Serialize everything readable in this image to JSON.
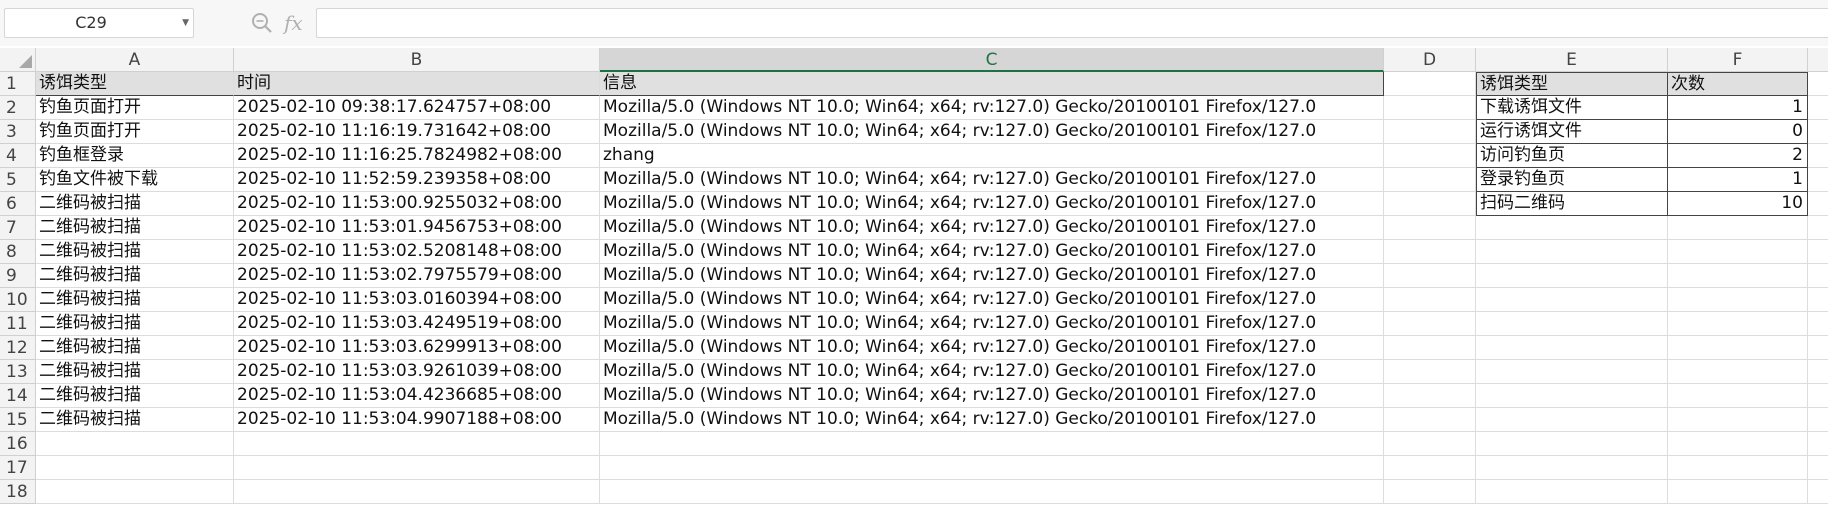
{
  "formula_bar": {
    "name_box": "C29",
    "fx_symbol": "fx",
    "formula_value": ""
  },
  "columns": [
    {
      "label": "A",
      "selected": false
    },
    {
      "label": "B",
      "selected": false
    },
    {
      "label": "C",
      "selected": true
    },
    {
      "label": "D",
      "selected": false
    },
    {
      "label": "E",
      "selected": false
    },
    {
      "label": "F",
      "selected": false
    }
  ],
  "rows": [
    {
      "n": "1",
      "a": "诱饵类型",
      "b": "时间",
      "c": "信息",
      "e": "诱饵类型",
      "f": "次数"
    },
    {
      "n": "2",
      "a": "钓鱼页面打开",
      "b": "2025-02-10 09:38:17.624757+08:00",
      "c": "Mozilla/5.0 (Windows NT 10.0; Win64; x64; rv:127.0) Gecko/20100101 Firefox/127.0",
      "e": "下载诱饵文件",
      "f": "1"
    },
    {
      "n": "3",
      "a": "钓鱼页面打开",
      "b": "2025-02-10 11:16:19.731642+08:00",
      "c": "Mozilla/5.0 (Windows NT 10.0; Win64; x64; rv:127.0) Gecko/20100101 Firefox/127.0",
      "e": "运行诱饵文件",
      "f": "0"
    },
    {
      "n": "4",
      "a": "钓鱼框登录",
      "b": "2025-02-10 11:16:25.7824982+08:00",
      "c": "zhang",
      "e": "访问钓鱼页",
      "f": "2"
    },
    {
      "n": "5",
      "a": "钓鱼文件被下载",
      "b": "2025-02-10 11:52:59.239358+08:00",
      "c": "Mozilla/5.0 (Windows NT 10.0; Win64; x64; rv:127.0) Gecko/20100101 Firefox/127.0",
      "e": "登录钓鱼页",
      "f": "1"
    },
    {
      "n": "6",
      "a": "二维码被扫描",
      "b": "2025-02-10 11:53:00.9255032+08:00",
      "c": "Mozilla/5.0 (Windows NT 10.0; Win64; x64; rv:127.0) Gecko/20100101 Firefox/127.0",
      "e": "扫码二维码",
      "f": "10"
    },
    {
      "n": "7",
      "a": "二维码被扫描",
      "b": "2025-02-10 11:53:01.9456753+08:00",
      "c": "Mozilla/5.0 (Windows NT 10.0; Win64; x64; rv:127.0) Gecko/20100101 Firefox/127.0",
      "e": "",
      "f": ""
    },
    {
      "n": "8",
      "a": "二维码被扫描",
      "b": "2025-02-10 11:53:02.5208148+08:00",
      "c": "Mozilla/5.0 (Windows NT 10.0; Win64; x64; rv:127.0) Gecko/20100101 Firefox/127.0",
      "e": "",
      "f": ""
    },
    {
      "n": "9",
      "a": "二维码被扫描",
      "b": "2025-02-10 11:53:02.7975579+08:00",
      "c": "Mozilla/5.0 (Windows NT 10.0; Win64; x64; rv:127.0) Gecko/20100101 Firefox/127.0",
      "e": "",
      "f": ""
    },
    {
      "n": "10",
      "a": "二维码被扫描",
      "b": "2025-02-10 11:53:03.0160394+08:00",
      "c": "Mozilla/5.0 (Windows NT 10.0; Win64; x64; rv:127.0) Gecko/20100101 Firefox/127.0",
      "e": "",
      "f": ""
    },
    {
      "n": "11",
      "a": "二维码被扫描",
      "b": "2025-02-10 11:53:03.4249519+08:00",
      "c": "Mozilla/5.0 (Windows NT 10.0; Win64; x64; rv:127.0) Gecko/20100101 Firefox/127.0",
      "e": "",
      "f": ""
    },
    {
      "n": "12",
      "a": "二维码被扫描",
      "b": "2025-02-10 11:53:03.6299913+08:00",
      "c": "Mozilla/5.0 (Windows NT 10.0; Win64; x64; rv:127.0) Gecko/20100101 Firefox/127.0",
      "e": "",
      "f": ""
    },
    {
      "n": "13",
      "a": "二维码被扫描",
      "b": "2025-02-10 11:53:03.9261039+08:00",
      "c": "Mozilla/5.0 (Windows NT 10.0; Win64; x64; rv:127.0) Gecko/20100101 Firefox/127.0",
      "e": "",
      "f": ""
    },
    {
      "n": "14",
      "a": "二维码被扫描",
      "b": "2025-02-10 11:53:04.4236685+08:00",
      "c": "Mozilla/5.0 (Windows NT 10.0; Win64; x64; rv:127.0) Gecko/20100101 Firefox/127.0",
      "e": "",
      "f": ""
    },
    {
      "n": "15",
      "a": "二维码被扫描",
      "b": "2025-02-10 11:53:04.9907188+08:00",
      "c": "Mozilla/5.0 (Windows NT 10.0; Win64; x64; rv:127.0) Gecko/20100101 Firefox/127.0",
      "e": "",
      "f": ""
    },
    {
      "n": "16",
      "a": "",
      "b": "",
      "c": "",
      "e": "",
      "f": ""
    },
    {
      "n": "17",
      "a": "",
      "b": "",
      "c": "",
      "e": "",
      "f": ""
    },
    {
      "n": "18",
      "a": "",
      "b": "",
      "c": "",
      "e": "",
      "f": ""
    }
  ]
}
